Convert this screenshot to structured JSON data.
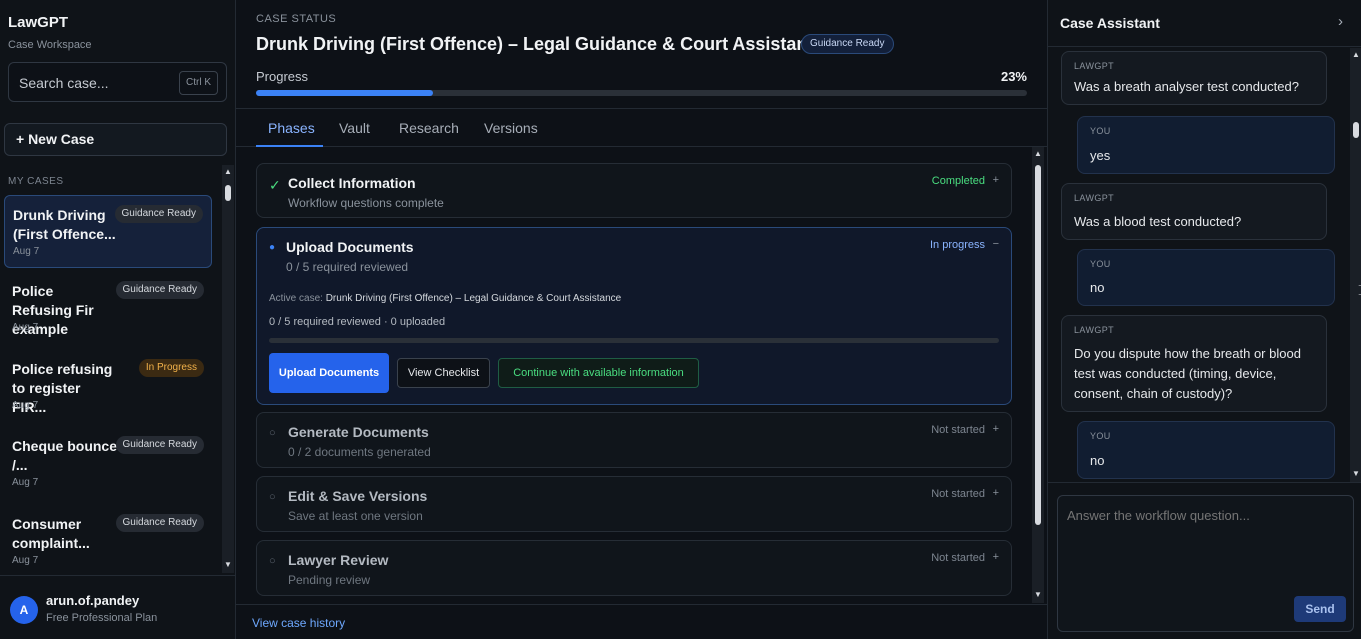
{
  "sidebar": {
    "brand": "LawGPT",
    "brand_sub": "Case Workspace",
    "search_placeholder": "Search case...",
    "search_shortcut": "Ctrl K",
    "new_case_label": "+ New Case",
    "section_label": "MY CASES",
    "cases": [
      {
        "title": "Drunk Driving (First Offence...",
        "date": "Aug 7",
        "badge": "Guidance Ready"
      },
      {
        "title": "Police Refusing Fir example",
        "date": "Aug 7",
        "badge": "Guidance Ready"
      },
      {
        "title": "Police refusing to register FIR...",
        "date": "Aug 7",
        "badge": "In Progress"
      },
      {
        "title": "Cheque bounce /...",
        "date": "Aug 7",
        "badge": "Guidance Ready"
      },
      {
        "title": "Consumer complaint...",
        "date": "Aug 7",
        "badge": "Guidance Ready"
      }
    ],
    "user": {
      "initial": "A",
      "name": "arun.of.pandey",
      "plan": "Free Professional Plan"
    }
  },
  "main": {
    "status_label": "CASE STATUS",
    "title": "Drunk Driving (First Offence) – Legal Guidance & Court Assistance",
    "title_badge": "Guidance Ready",
    "progress_label": "Progress",
    "progress_text": "23%",
    "progress_value": 23,
    "tabs": [
      "Phases",
      "Vault",
      "Research",
      "Versions"
    ],
    "phases": [
      {
        "title": "Collect Information",
        "sub": "Workflow questions complete",
        "status": "Completed",
        "toggle": "+"
      },
      {
        "title": "Upload Documents",
        "sub": "0 / 5 required reviewed",
        "status": "In progress",
        "toggle": "−"
      },
      {
        "title": "Generate Documents",
        "sub": "0 / 2 documents generated",
        "status": "Not started",
        "toggle": "+"
      },
      {
        "title": "Edit & Save Versions",
        "sub": "Save at least one version",
        "status": "Not started",
        "toggle": "+"
      },
      {
        "title": "Lawyer Review",
        "sub": "Pending review",
        "status": "Not started",
        "toggle": "+"
      }
    ],
    "upload": {
      "active_label": "Active case:",
      "active_case": "Drunk Driving (First Offence) – Legal Guidance & Court Assistance",
      "summary": "0 / 5 required reviewed · 0 uploaded",
      "btn_upload": "Upload Documents",
      "btn_checklist": "View Checklist",
      "btn_continue": "Continue with available information"
    },
    "history_link": "View case history"
  },
  "assistant": {
    "title": "Case Assistant",
    "messages": [
      {
        "role": "LAWGPT",
        "text": "Was a breath analyser test conducted?"
      },
      {
        "role": "YOU",
        "text": "yes"
      },
      {
        "role": "LAWGPT",
        "text": "Was a blood test conducted?"
      },
      {
        "role": "YOU",
        "text": "no"
      },
      {
        "role": "LAWGPT",
        "text": "Do you dispute how the breath or blood test was conducted (timing, device, consent, chain of custody)?"
      },
      {
        "role": "YOU",
        "text": "no"
      }
    ],
    "input_placeholder": "Answer the workflow question...",
    "send_label": "Send"
  },
  "colors": {
    "accent": "#3b82f6",
    "completed": "#4ade80",
    "in_progress": "#f3b24a"
  },
  "icons": [
    "check-icon",
    "dot-icon",
    "circle-icon",
    "chevron-right-icon",
    "cursor-icon"
  ]
}
